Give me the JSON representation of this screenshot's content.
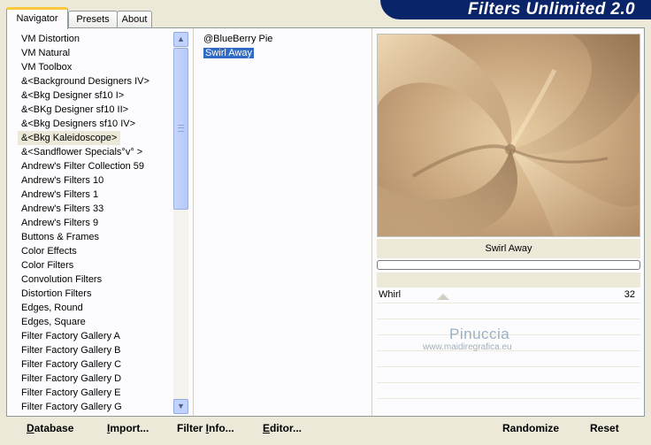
{
  "tabs": [
    "Navigator",
    "Presets",
    "About"
  ],
  "banner": "Filters Unlimited 2.0",
  "categories": [
    "VM Distortion",
    "VM Natural",
    "VM Toolbox",
    "&<Background Designers IV>",
    "&<Bkg Designer sf10 I>",
    "&<BKg Designer sf10 II>",
    "&<Bkg Designers sf10 IV>",
    "&<Bkg Kaleidoscope>",
    "&<Sandflower Specials°v° >",
    "Andrew's Filter Collection 59",
    "Andrew's Filters 10",
    "Andrew's Filters 1",
    "Andrew's Filters 33",
    "Andrew's Filters 9",
    "Buttons & Frames",
    "Color Effects",
    "Color Filters",
    "Convolution Filters",
    "Distortion Filters",
    "Edges, Round",
    "Edges, Square",
    "Filter Factory Gallery A",
    "Filter Factory Gallery B",
    "Filter Factory Gallery C",
    "Filter Factory Gallery D",
    "Filter Factory Gallery E",
    "Filter Factory Gallery G"
  ],
  "selected_category": "&<Bkg Kaleidoscope>",
  "filters": [
    "@BlueBerry Pie",
    "Swirl Away"
  ],
  "selected_filter": "Swirl Away",
  "preview": {
    "filter_title": "Swirl Away",
    "colors": {
      "light": "#E8CFA6",
      "mid": "#C9A67E",
      "dark": "#8F6F4E"
    }
  },
  "parameters": [
    {
      "name": "Whirl",
      "value": "32",
      "level": 32
    }
  ],
  "watermark": {
    "name": "Pinuccia",
    "url": "www.maidiregrafica.eu"
  },
  "buttons": {
    "database_first": "D",
    "database_rest": "atabase",
    "import_first": "I",
    "import_rest": "mport...",
    "filter_info_pre": "Filter ",
    "filter_info_ul": "I",
    "filter_info_rest": "nfo...",
    "editor_first": "E",
    "editor_rest": "ditor...",
    "randomize": "Randomize",
    "reset": "Reset"
  }
}
